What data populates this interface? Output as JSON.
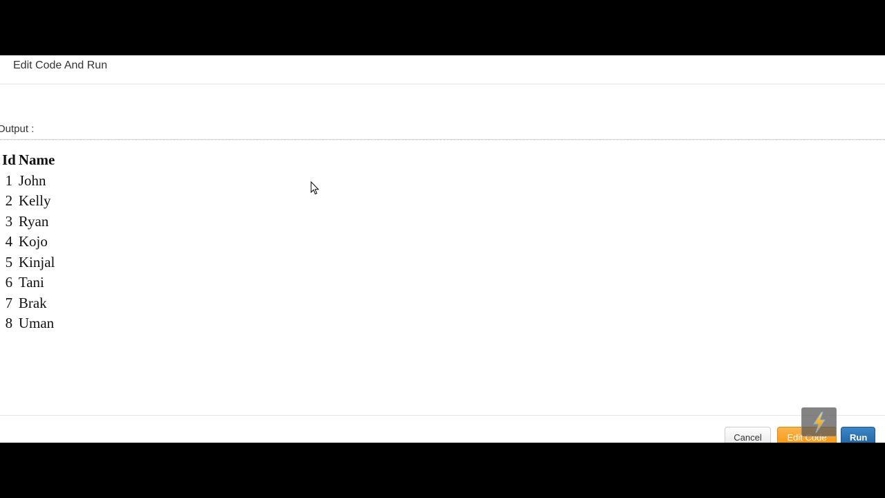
{
  "modal": {
    "title": "Edit Code And Run",
    "output_label": "Output :"
  },
  "table": {
    "headers": [
      "Id",
      "Name"
    ],
    "rows": [
      {
        "id": "1",
        "name": "John"
      },
      {
        "id": "2",
        "name": "Kelly"
      },
      {
        "id": "3",
        "name": "Ryan"
      },
      {
        "id": "4",
        "name": "Kojo"
      },
      {
        "id": "5",
        "name": "Kinjal"
      },
      {
        "id": "6",
        "name": "Tani"
      },
      {
        "id": "7",
        "name": "Brak"
      },
      {
        "id": "8",
        "name": "Uman"
      }
    ]
  },
  "footer": {
    "cancel_label": "Cancel",
    "edit_label": "Edit Code",
    "run_label": "Run"
  },
  "colors": {
    "edit_button": "#f89406",
    "run_button": "#2a6fb0",
    "letterbox": "#000000"
  },
  "icons": {
    "overlay": "lightning-bolt-icon",
    "cursor": "mouse-pointer-icon"
  }
}
